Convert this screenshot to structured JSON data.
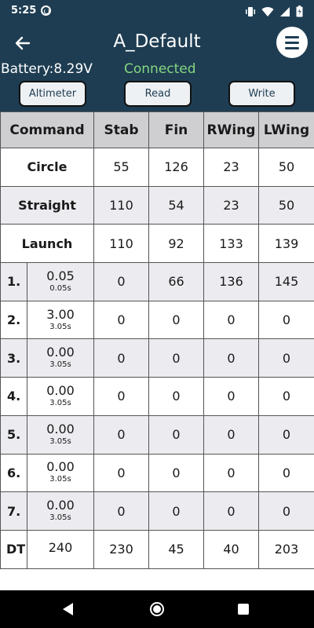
{
  "status": {
    "time": "5:25"
  },
  "app": {
    "title": "A_Default",
    "battery": "Battery:8.29V",
    "connection": "Connected",
    "buttons": {
      "altimeter": "Altimeter",
      "read": "Read",
      "write": "Write"
    }
  },
  "table": {
    "headers": [
      "Command",
      "Stab",
      "Fin",
      "RWing",
      "LWing"
    ],
    "named_rows": [
      {
        "label": "Circle",
        "values": [
          "55",
          "126",
          "23",
          "50"
        ]
      },
      {
        "label": "Straight",
        "values": [
          "110",
          "54",
          "23",
          "50"
        ]
      },
      {
        "label": "Launch",
        "values": [
          "110",
          "92",
          "133",
          "139"
        ]
      }
    ],
    "step_rows": [
      {
        "num": "1.",
        "time": "0.05",
        "cum": "0.05s",
        "values": [
          "0",
          "66",
          "136",
          "145"
        ]
      },
      {
        "num": "2.",
        "time": "3.00",
        "cum": "3.05s",
        "values": [
          "0",
          "0",
          "0",
          "0"
        ]
      },
      {
        "num": "3.",
        "time": "0.00",
        "cum": "3.05s",
        "values": [
          "0",
          "0",
          "0",
          "0"
        ]
      },
      {
        "num": "4.",
        "time": "0.00",
        "cum": "3.05s",
        "values": [
          "0",
          "0",
          "0",
          "0"
        ]
      },
      {
        "num": "5.",
        "time": "0.00",
        "cum": "3.05s",
        "values": [
          "0",
          "0",
          "0",
          "0"
        ]
      },
      {
        "num": "6.",
        "time": "0.00",
        "cum": "3.05s",
        "values": [
          "0",
          "0",
          "0",
          "0"
        ]
      },
      {
        "num": "7.",
        "time": "0.00",
        "cum": "3.05s",
        "values": [
          "0",
          "0",
          "0",
          "0"
        ]
      }
    ],
    "dt_row": {
      "label": "DT",
      "time": "240",
      "values": [
        "230",
        "45",
        "40",
        "203"
      ]
    }
  },
  "colors": {
    "app_bar": "#1e3d52",
    "connected": "#84d680",
    "header_bg": "#cfcfd2",
    "grey_row": "#ececf0"
  }
}
